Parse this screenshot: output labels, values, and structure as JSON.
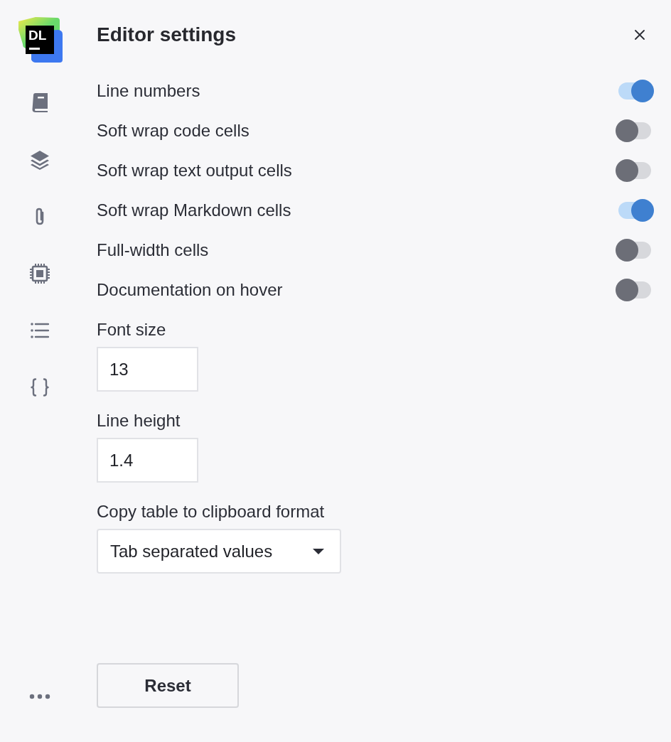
{
  "logo": {
    "text": "DL"
  },
  "panel": {
    "title": "Editor settings"
  },
  "toggles": [
    {
      "label": "Line numbers",
      "on": true
    },
    {
      "label": "Soft wrap code cells",
      "on": false
    },
    {
      "label": "Soft wrap text output cells",
      "on": false
    },
    {
      "label": "Soft wrap Markdown cells",
      "on": true
    },
    {
      "label": "Full-width cells",
      "on": false
    },
    {
      "label": "Documentation on hover",
      "on": false
    }
  ],
  "fields": [
    {
      "kind": "number",
      "label": "Font size",
      "value": "13"
    },
    {
      "kind": "number",
      "label": "Line height",
      "value": "1.4"
    },
    {
      "kind": "select",
      "label": "Copy table to clipboard format",
      "value": "Tab separated values"
    }
  ],
  "buttons": [
    {
      "label": "Reset"
    }
  ]
}
